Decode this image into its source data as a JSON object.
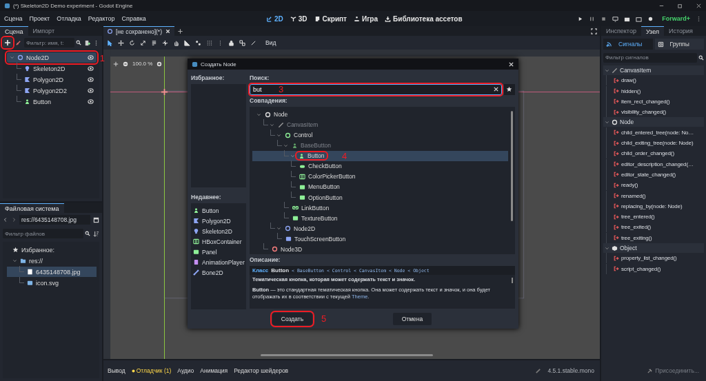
{
  "window": {
    "title": "(*) Skeleton2D Demo experiment - Godot Engine"
  },
  "menu": [
    "Сцена",
    "Проект",
    "Отладка",
    "Редактор",
    "Справка"
  ],
  "workspaces": [
    {
      "label": "2D",
      "kind": "vector",
      "selected": true
    },
    {
      "label": "3D",
      "kind": "axes",
      "selected": false
    },
    {
      "label": "Скрипт",
      "kind": "script",
      "selected": false
    },
    {
      "label": "Игра",
      "kind": "game",
      "selected": false
    },
    {
      "label": "Библиотека ассетов",
      "kind": "assets",
      "selected": false
    }
  ],
  "renderer": "Forward+",
  "scene_dock": {
    "tabs": [
      {
        "label": "Сцена",
        "selected": true
      },
      {
        "label": "Импорт",
        "selected": false
      }
    ],
    "add_button": {
      "highlighted": true
    },
    "filter_placeholder": "Фильтр: имя, t:",
    "tree": [
      {
        "name": "Node2D",
        "kind": "node2d",
        "visible": true,
        "selected": true,
        "highlighted": true,
        "callout": "1",
        "expanded": true,
        "children": [
          {
            "name": "Skeleton2D",
            "kind": "skeleton2d",
            "visible": true,
            "selected": false,
            "highlighted": false
          },
          {
            "name": "Polygon2D",
            "kind": "polygon2d",
            "visible": true,
            "selected": false,
            "highlighted": false
          },
          {
            "name": "Polygon2D2",
            "kind": "polygon2d",
            "visible": true,
            "selected": false,
            "highlighted": false
          },
          {
            "name": "Button",
            "kind": "button",
            "visible": true,
            "selected": false,
            "highlighted": false
          }
        ]
      }
    ]
  },
  "filesystem": {
    "tab": "Файловая система",
    "path": "res://6435148708.jpg",
    "filter_placeholder": "Фильтр файлов",
    "tree": [
      {
        "name": "Избранное:",
        "kind": "star",
        "selected": false
      },
      {
        "name": "res://",
        "kind": "folder",
        "selected": false,
        "expanded": true,
        "children": [
          {
            "name": "6435148708.jpg",
            "kind": "image",
            "selected": true
          },
          {
            "name": "icon.svg",
            "kind": "svgfile",
            "selected": false
          }
        ]
      }
    ]
  },
  "editor_tabs": [
    {
      "label": "[не сохранено](*)",
      "selected": true
    }
  ],
  "toolbar": {
    "tools": [
      {
        "kind": "select",
        "selected": true
      },
      {
        "kind": "move",
        "selected": false
      },
      {
        "kind": "rotate",
        "selected": false
      },
      {
        "kind": "scale",
        "selected": false
      },
      {
        "kind": "list",
        "selected": false
      },
      {
        "kind": "pivot",
        "selected": false
      },
      {
        "kind": "pan",
        "selected": false
      },
      {
        "kind": "ruler",
        "selected": false
      },
      {
        "kind": "snap",
        "selected": false
      },
      {
        "kind": "grid",
        "selected": false
      },
      {
        "kind": "more",
        "selected": false
      },
      {
        "kind": "lock",
        "selected": false
      },
      {
        "kind": "group",
        "selected": false
      },
      {
        "kind": "bone",
        "selected": false
      }
    ],
    "view_menu": "Вид"
  },
  "viewport": {
    "zoom": "100.0 %"
  },
  "dialog": {
    "title": "Создать Node",
    "favorites_label": "Избранное:",
    "recent_label": "Недавнее:",
    "recent": [
      {
        "name": "Button",
        "kind": "button"
      },
      {
        "name": "Polygon2D",
        "kind": "polygon2d"
      },
      {
        "name": "Skeleton2D",
        "kind": "skeleton2d"
      },
      {
        "name": "HBoxContainer",
        "kind": "hbox"
      },
      {
        "name": "Panel",
        "kind": "panel"
      },
      {
        "name": "AnimationPlayer",
        "kind": "animplayer"
      },
      {
        "name": "Bone2D",
        "kind": "bone2d"
      }
    ],
    "search_label": "Поиск:",
    "search": {
      "value": "but",
      "highlighted": true,
      "callout": "3"
    },
    "matches_label": "Совпадения:",
    "matches": [
      {
        "name": "Node",
        "kind": "node",
        "disabled": false,
        "selected": false,
        "highlighted": false,
        "expanded": true,
        "children": [
          {
            "name": "CanvasItem",
            "kind": "canvasitem",
            "disabled": true,
            "selected": false,
            "highlighted": false,
            "expanded": true,
            "children": [
              {
                "name": "Control",
                "kind": "control",
                "disabled": false,
                "selected": false,
                "highlighted": false,
                "expanded": true,
                "children": [
                  {
                    "name": "BaseButton",
                    "kind": "basebutton",
                    "disabled": true,
                    "selected": false,
                    "highlighted": false,
                    "expanded": true,
                    "children": [
                      {
                        "name": "Button",
                        "kind": "button",
                        "disabled": false,
                        "selected": true,
                        "highlighted": true,
                        "callout": "4",
                        "expanded": true,
                        "children": [
                          {
                            "name": "CheckButton",
                            "kind": "checkbutton",
                            "disabled": false,
                            "selected": false,
                            "highlighted": false
                          },
                          {
                            "name": "ColorPickerButton",
                            "kind": "colorpicker",
                            "disabled": false,
                            "selected": false,
                            "highlighted": false
                          },
                          {
                            "name": "MenuButton",
                            "kind": "menubutton",
                            "disabled": false,
                            "selected": false,
                            "highlighted": false
                          },
                          {
                            "name": "OptionButton",
                            "kind": "optionbutton",
                            "disabled": false,
                            "selected": false,
                            "highlighted": false
                          }
                        ]
                      },
                      {
                        "name": "LinkButton",
                        "kind": "linkbutton",
                        "disabled": false,
                        "selected": false,
                        "highlighted": false
                      },
                      {
                        "name": "TextureButton",
                        "kind": "texturebutton",
                        "disabled": false,
                        "selected": false,
                        "highlighted": false
                      }
                    ]
                  }
                ]
              },
              {
                "name": "Node2D",
                "kind": "node2d",
                "disabled": false,
                "selected": false,
                "highlighted": false,
                "expanded": true,
                "children": [
                  {
                    "name": "TouchScreenButton",
                    "kind": "touchscreen",
                    "disabled": false,
                    "selected": false,
                    "highlighted": false
                  }
                ]
              }
            ]
          },
          {
            "name": "Node3D",
            "kind": "node3d",
            "disabled": false,
            "selected": false,
            "highlighted": false
          }
        ]
      }
    ],
    "description_label": "Описание:",
    "class_keyword": "Класс",
    "class_name": "Button",
    "inheritance": "< BaseButton < Control < CanvasItem < Node < Object",
    "brief": "Тематическая кнопка, которая может содержать текст и значок.",
    "description": "**Button** — это стандартная тематическая кнопка. Она может содержать текст и значок, и она будет отображать их в соответствии с текущей",
    "description_link": "Theme",
    "description_end": ".",
    "confirm": {
      "label": "Создать",
      "highlighted": true,
      "callout": "5"
    },
    "cancel": {
      "label": "Отмена"
    }
  },
  "bottom_panel": {
    "tabs": [
      {
        "label": "Вывод",
        "alert": false
      },
      {
        "label": "Отладчик (1)",
        "alert": true
      },
      {
        "label": "Аудио",
        "alert": false
      },
      {
        "label": "Анимация",
        "alert": false
      },
      {
        "label": "Редактор шейдеров",
        "alert": false
      }
    ],
    "version": "4.5.1.stable.mono"
  },
  "node_dock": {
    "tabs": [
      {
        "label": "Инспектор",
        "selected": false
      },
      {
        "label": "Узел",
        "selected": true
      },
      {
        "label": "История",
        "selected": false
      }
    ],
    "subtabs": [
      {
        "label": "Сигналы",
        "kind": "signals",
        "selected": true
      },
      {
        "label": "Группы",
        "kind": "groups",
        "selected": false
      }
    ],
    "filter_placeholder": "Фильтр сигналов",
    "groups": [
      {
        "name": "CanvasItem",
        "kind": "canvasitem",
        "expanded": true,
        "signals": [
          "draw()",
          "hidden()",
          "item_rect_changed()",
          "visibility_changed()"
        ]
      },
      {
        "name": "Node",
        "kind": "node",
        "expanded": true,
        "signals": [
          "child_entered_tree(node: No…",
          "child_exiting_tree(node: Node)",
          "child_order_changed()",
          "editor_description_changed(…",
          "editor_state_changed()",
          "ready()",
          "renamed()",
          "replacing_by(node: Node)",
          "tree_entered()",
          "tree_exited()",
          "tree_exiting()"
        ]
      },
      {
        "name": "Object",
        "kind": "object",
        "expanded": true,
        "signals": [
          "property_list_changed()",
          "script_changed()"
        ]
      }
    ],
    "connect_button": {
      "label": "Присоединить...",
      "disabled": true
    }
  }
}
